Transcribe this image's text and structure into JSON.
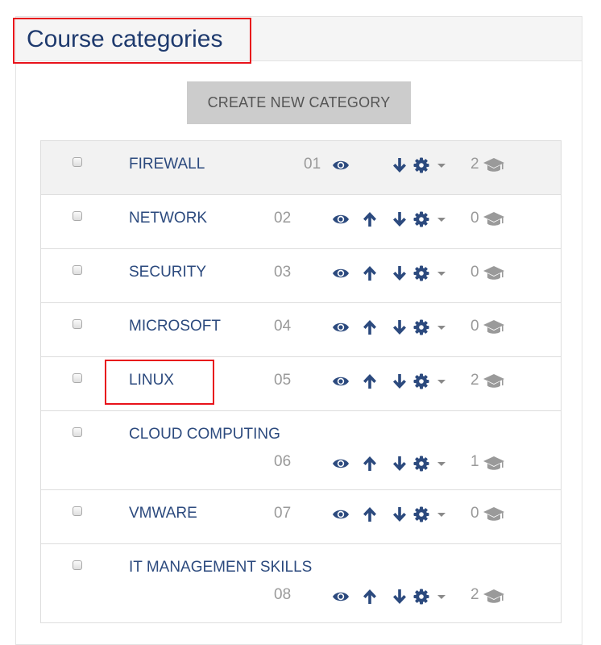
{
  "page": {
    "title": "Course categories"
  },
  "actions": {
    "create_label": "CREATE NEW CATEGORY"
  },
  "colors": {
    "accent": "#2c4a7e",
    "highlight": "#e8121b",
    "button_bg": "#cccccc"
  },
  "categories": [
    {
      "name": "FIREWALL",
      "idnumber": "01",
      "course_count": "2",
      "highlighted": true,
      "can_move_up": false,
      "two_line": false
    },
    {
      "name": "NETWORK",
      "idnumber": "02",
      "course_count": "0",
      "highlighted": false,
      "can_move_up": true,
      "two_line": false
    },
    {
      "name": "SECURITY",
      "idnumber": "03",
      "course_count": "0",
      "highlighted": false,
      "can_move_up": true,
      "two_line": false
    },
    {
      "name": "MICROSOFT",
      "idnumber": "04",
      "course_count": "0",
      "highlighted": false,
      "can_move_up": true,
      "two_line": false
    },
    {
      "name": "LINUX",
      "idnumber": "05",
      "course_count": "2",
      "highlighted": false,
      "can_move_up": true,
      "two_line": false
    },
    {
      "name": "CLOUD COMPUTING",
      "idnumber": "06",
      "course_count": "1",
      "highlighted": false,
      "can_move_up": true,
      "two_line": true
    },
    {
      "name": "VMWARE",
      "idnumber": "07",
      "course_count": "0",
      "highlighted": false,
      "can_move_up": true,
      "two_line": false
    },
    {
      "name": "IT MANAGEMENT SKILLS",
      "idnumber": "08",
      "course_count": "2",
      "highlighted": false,
      "can_move_up": true,
      "two_line": true
    }
  ],
  "icons": [
    "checkbox",
    "eye-icon",
    "arrow-up-icon",
    "arrow-down-icon",
    "gear-icon",
    "caret-down-icon",
    "graduation-cap-icon"
  ]
}
